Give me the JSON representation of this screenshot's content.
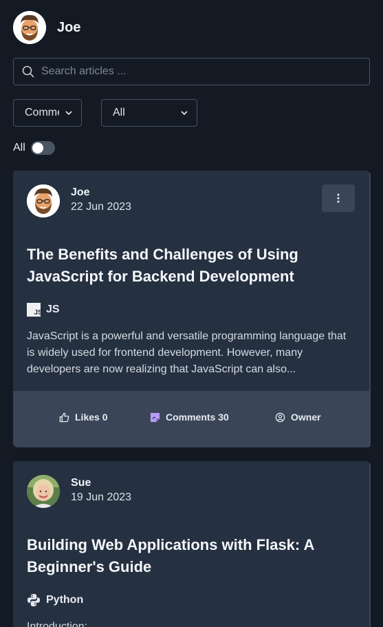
{
  "user": {
    "name": "Joe"
  },
  "search": {
    "placeholder": "Search articles ..."
  },
  "filters": {
    "sort": {
      "value": "Comments"
    },
    "category": {
      "value": "All"
    },
    "toggle": {
      "label": "All",
      "on": false
    }
  },
  "articles": [
    {
      "author": "Joe",
      "date": "22 Jun 2023",
      "title": "The Benefits and Challenges of Using JavaScript for Backend Development",
      "tag": {
        "label": "JS",
        "icon": "javascript-icon"
      },
      "excerpt": "JavaScript is a powerful and versatile programming language that is widely used for frontend development. However, many developers are now realizing that JavaScript can also...",
      "actions": {
        "likes": "Likes 0",
        "comments": "Comments 30",
        "owner": "Owner"
      }
    },
    {
      "author": "Sue",
      "date": "19 Jun 2023",
      "title": "Building Web Applications with Flask: A Beginner's Guide",
      "tag": {
        "label": "Python",
        "icon": "python-icon"
      },
      "excerpt": "Introduction:"
    }
  ],
  "colors": {
    "background": "#131a24",
    "card": "#253041",
    "footer": "#3a4658",
    "accent": "#b79cf7"
  }
}
